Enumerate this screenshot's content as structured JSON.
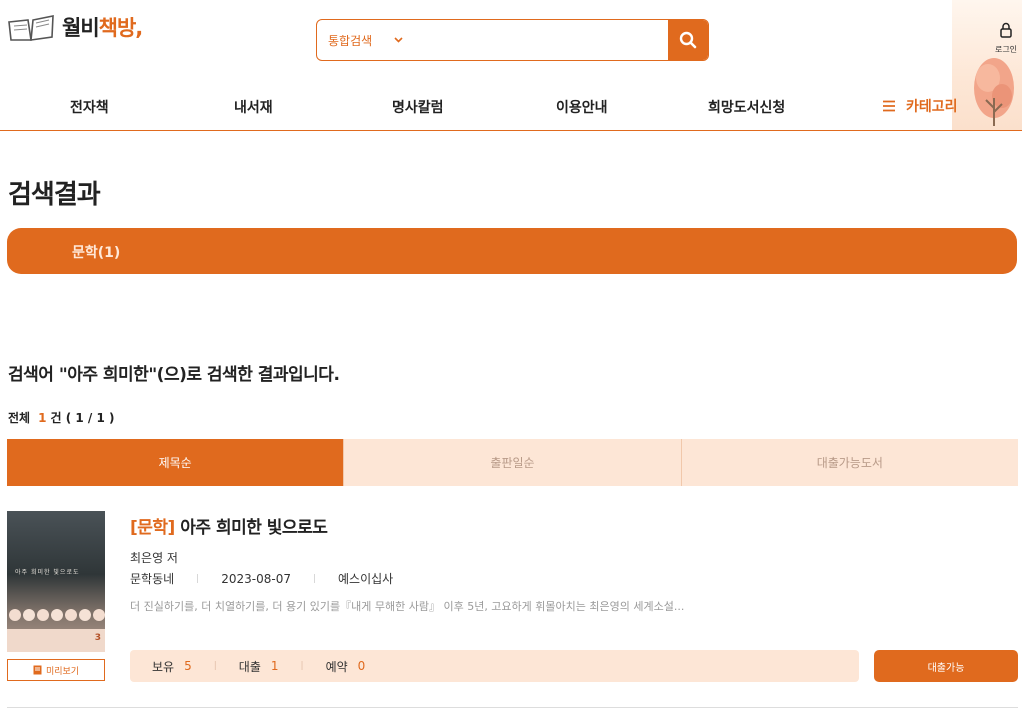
{
  "header": {
    "logo_part1": "월비",
    "logo_part2": "책방,",
    "search": {
      "scope": "통합검색",
      "placeholder": ""
    },
    "login_label": "로그인"
  },
  "nav": {
    "items": [
      "전자책",
      "내서재",
      "명사칼럼",
      "이용안내",
      "희망도서신청"
    ],
    "category_label": "카테고리"
  },
  "main": {
    "page_title": "검색결과",
    "category_filter": "문학(1)",
    "result_message": "검색어 \"아주 희미한\"(으)로 검색한 결과입니다.",
    "count": {
      "label": "전체",
      "value": "1",
      "unit": "건",
      "pages": "( 1 / 1 )"
    },
    "tabs": [
      "제목순",
      "출판일순",
      "대출가능도서"
    ],
    "active_tab": "제목순"
  },
  "book": {
    "category_tag": "[문학]",
    "title": "아주 희미한 빛으로도",
    "author": "최은영 저",
    "collection": "문학동네",
    "pub_date": "2023-08-07",
    "publisher": "예스이십사",
    "description": "더 진실하기를, 더 치열하기를, 더 용기 있기를『내게 무해한 사람』 이후 5년, 고요하게 휘몰아치는 최은영의 세계소설...",
    "preview_label": "미리보기",
    "stock": [
      {
        "label": "보유",
        "value": "5"
      },
      {
        "label": "대출",
        "value": "1"
      },
      {
        "label": "예약",
        "value": "0"
      }
    ],
    "loan_label": "대출가능",
    "cover_text": "아주 희미한 빛으로도",
    "cover_badge": "3"
  },
  "colors": {
    "accent": "#e06a1e",
    "tab_bg": "#fde6d6"
  }
}
